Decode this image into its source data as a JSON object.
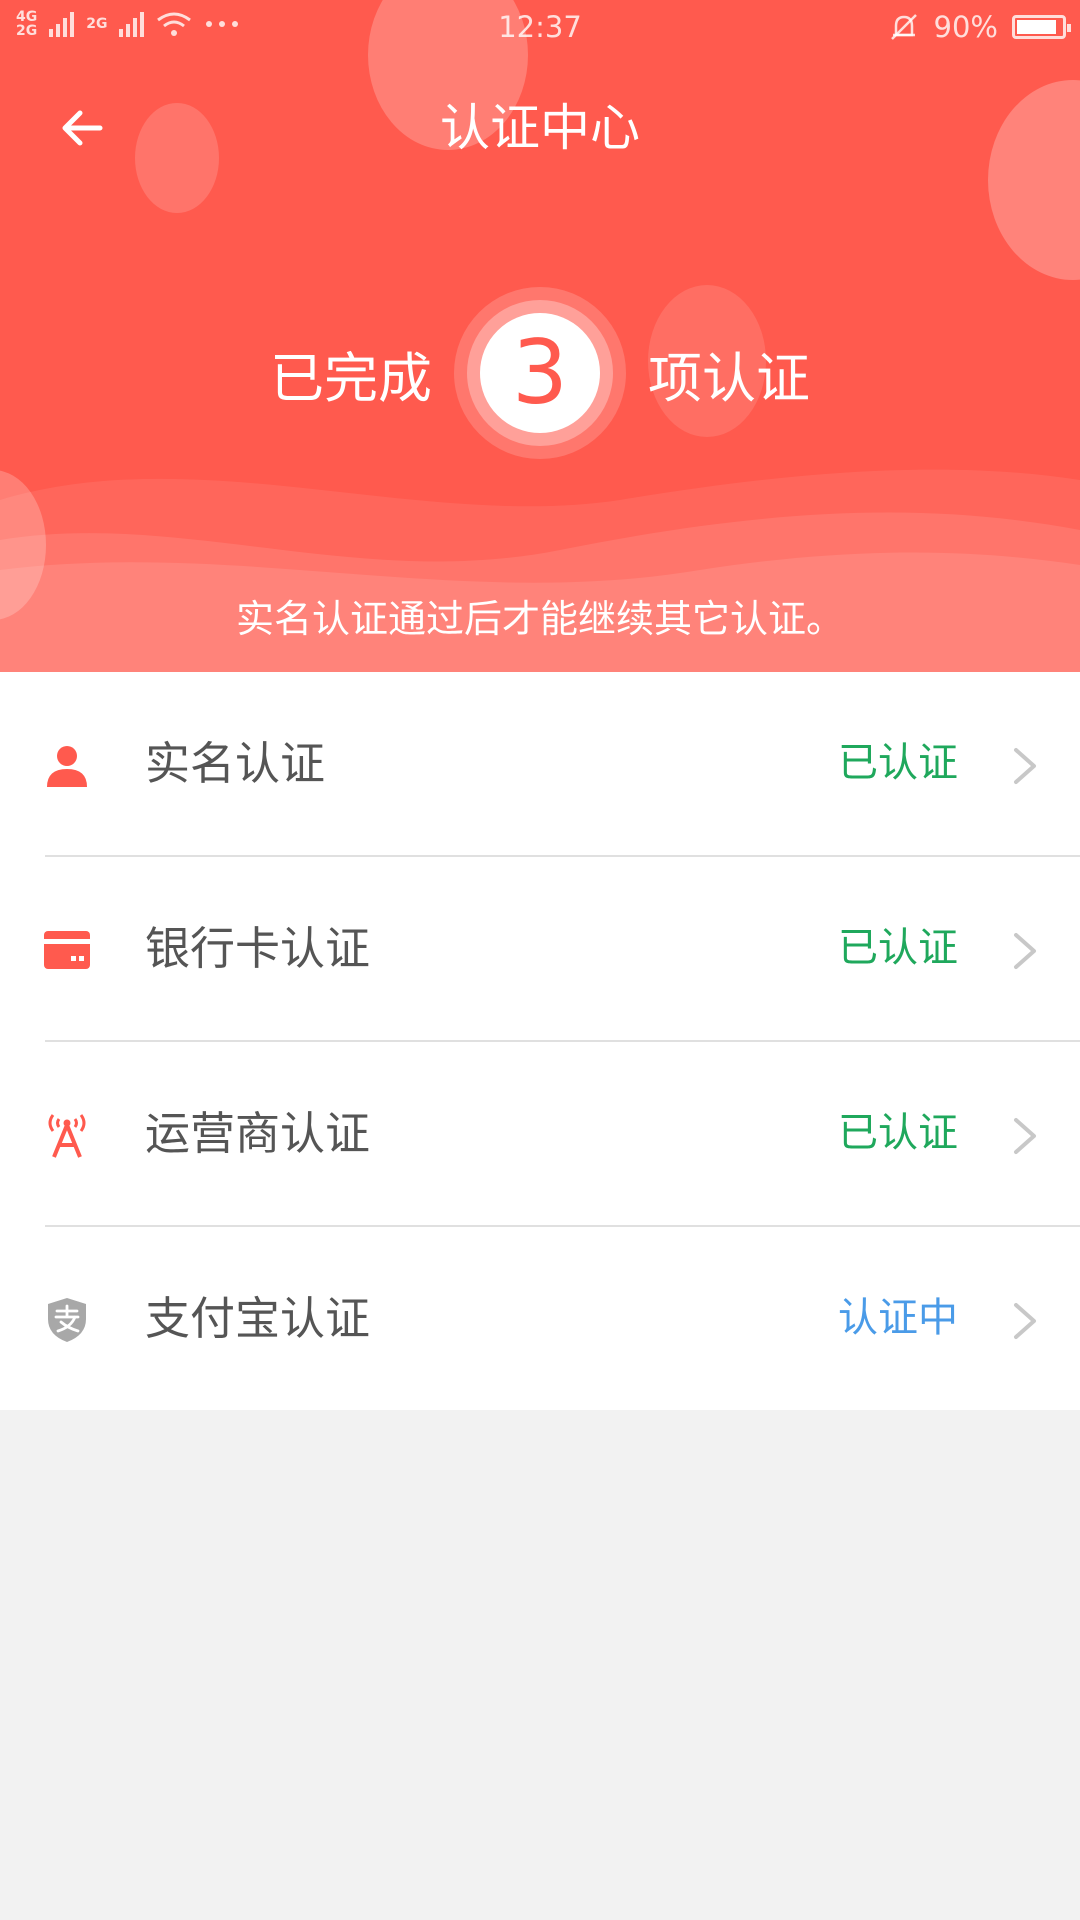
{
  "status_bar": {
    "network_top": "4G",
    "network_bottom": "2G",
    "network2": "2G",
    "time": "12:37",
    "battery": "90%",
    "battery_level": 0.9
  },
  "header": {
    "title": "认证中心",
    "completed_prefix": "已完成",
    "completed_count": "3",
    "completed_suffix": "项认证",
    "notice": "实名认证通过后才能继续其它认证。"
  },
  "colors": {
    "brand": "#ff5a4e",
    "verified": "#1fa85c",
    "pending": "#4a9be8"
  },
  "items": [
    {
      "icon": "person-icon",
      "label": "实名认证",
      "status": "已认证",
      "state": "verified"
    },
    {
      "icon": "bank-card-icon",
      "label": "银行卡认证",
      "status": "已认证",
      "state": "verified"
    },
    {
      "icon": "signal-tower-icon",
      "label": "运营商认证",
      "status": "已认证",
      "state": "verified"
    },
    {
      "icon": "alipay-shield-icon",
      "label": "支付宝认证",
      "status": "认证中",
      "state": "pending"
    }
  ]
}
